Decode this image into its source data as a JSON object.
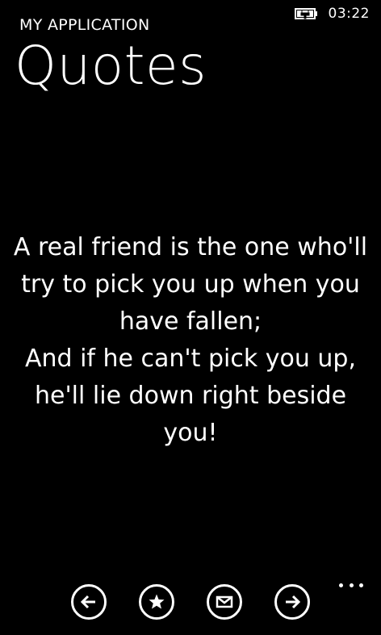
{
  "status_bar": {
    "time": "03:22",
    "battery_icon": "battery-charging-icon"
  },
  "header": {
    "app_title": "MY APPLICATION",
    "page_title": "Quotes"
  },
  "quote": {
    "lines": [
      "A real friend is the one who'll",
      "try to pick you up when you",
      "have fallen;",
      "And if he can't pick you up,",
      "he'll lie down right beside",
      "you!"
    ]
  },
  "app_bar": {
    "buttons": [
      {
        "icon": "arrow-left-icon"
      },
      {
        "icon": "star-icon"
      },
      {
        "icon": "mail-icon"
      },
      {
        "icon": "arrow-right-icon"
      }
    ],
    "more_icon": "ellipsis-icon"
  },
  "colors": {
    "background": "#000000",
    "foreground": "#ffffff"
  }
}
